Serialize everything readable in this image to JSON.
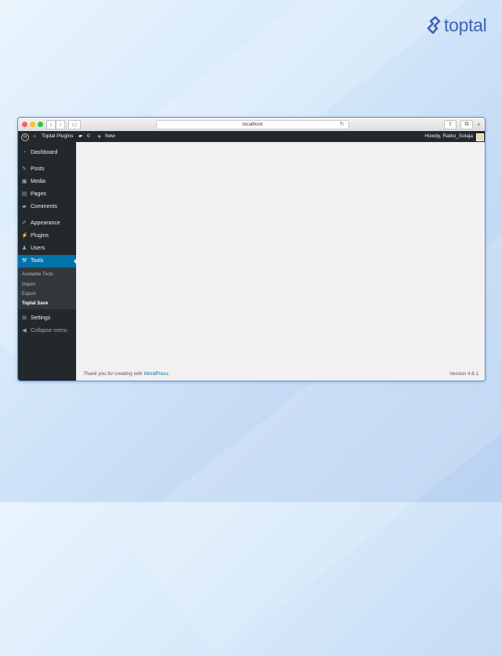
{
  "brand": {
    "logo_text": "toptal",
    "color": "#3f65b4"
  },
  "browser": {
    "url": "localhost"
  },
  "admin_bar": {
    "site_name": "Toptal Plugins",
    "comments_count": "0",
    "new_label": "New",
    "greeting": "Howdy, Ratko_Solaja"
  },
  "sidebar": {
    "dashboard": "Dashboard",
    "posts": "Posts",
    "media": "Media",
    "pages": "Pages",
    "comments": "Comments",
    "appearance": "Appearance",
    "plugins": "Plugins",
    "users": "Users",
    "tools": "Tools",
    "settings": "Settings",
    "collapse": "Collapse menu",
    "tools_submenu": {
      "available_tools": "Available Tools",
      "import": "Import",
      "export": "Export",
      "toptal_save": "Toptal Save"
    }
  },
  "footer": {
    "thanks_prefix": "Thank you for creating with ",
    "wordpress_link": "WordPress",
    "period": ".",
    "version": "Version 4.6.1"
  },
  "colors": {
    "admin_dark": "#23282d",
    "submenu_bg": "#32373c",
    "active_blue": "#0073aa",
    "content_bg": "#f1f1f1"
  }
}
